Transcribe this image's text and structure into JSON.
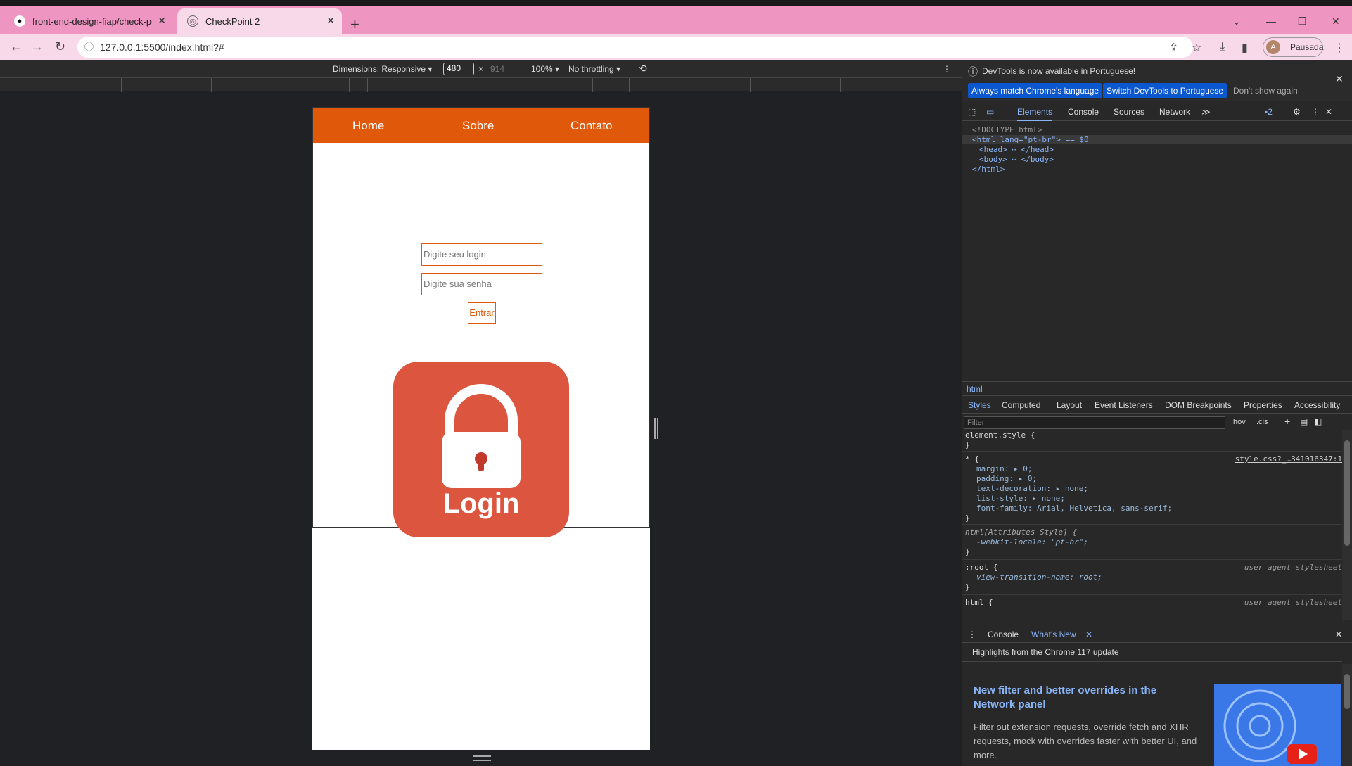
{
  "browser": {
    "tabs": [
      {
        "title": "front-end-design-fiap/check-po",
        "icon": "github-icon"
      },
      {
        "title": "CheckPoint 2",
        "icon": "globe-icon"
      }
    ],
    "address": "127.0.0.1:5500/index.html?#",
    "profile_initial": "A",
    "profile_label": "Pausada"
  },
  "device_toolbar": {
    "dimensions_label": "Dimensions: Responsive",
    "width_value": "480",
    "height_value": "914",
    "zoom_label": "100%",
    "throttle_label": "No throttling"
  },
  "site": {
    "nav": [
      "Home",
      "Sobre",
      "Contato"
    ],
    "login_placeholder": "Digite seu login",
    "password_placeholder": "Digite sua senha",
    "enter_label": "Entrar",
    "login_image_text": "Login",
    "nav_color": "#e0580a"
  },
  "devtools": {
    "banner_text": "DevTools is now available in Portuguese!",
    "banner_buttons": [
      "Always match Chrome's language",
      "Switch DevTools to Portuguese",
      "Don't show again"
    ],
    "tabs": [
      "Elements",
      "Console",
      "Sources",
      "Network"
    ],
    "issues_count": "2",
    "dom": [
      "<!DOCTYPE html>",
      "<html lang=\"pt-br\"> == $0",
      "<head> ⋯ </head>",
      "<body> ⋯ </body>",
      "</html>"
    ],
    "breadcrumb": "html",
    "style_tabs": [
      "Styles",
      "Computed",
      "Layout",
      "Event Listeners",
      "DOM Breakpoints",
      "Properties",
      "Accessibility"
    ],
    "filter_placeholder": "Filter",
    "hov_label": ":hov",
    "cls_label": ".cls",
    "rules": {
      "element_style": "element.style {",
      "star_selector": "* {",
      "star_source": "style.css?_…341016347:1",
      "star_props": [
        "margin: ▸ 0;",
        "padding: ▸ 0;",
        "text-decoration: ▸ none;",
        "list-style: ▸ none;",
        "font-family: Arial, Helvetica, sans-serif;"
      ],
      "attr_selector": "html[Attributes Style] {",
      "attr_prop": "-webkit-locale: \"pt-br\";",
      "root_selector": ":root {",
      "root_prop": "view-transition-name: root;",
      "ua_label": "user agent stylesheet",
      "html_selector": "html {"
    },
    "drawer_tabs": [
      "Console",
      "What's New"
    ],
    "whats_new_header": "Highlights from the Chrome 117 update",
    "whats_new_title": "New filter and better overrides in the Network panel",
    "whats_new_body": "Filter out extension requests, override fetch and XHR requests, mock with overrides faster with better UI, and more."
  }
}
